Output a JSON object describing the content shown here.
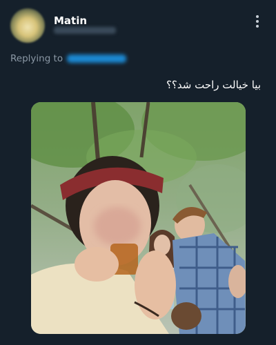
{
  "tweet": {
    "author_name": "Matin",
    "replying_to_label": "Replying to",
    "text": "بیا خیالت راحت شد؟؟",
    "more_icon": "more-vertical-icon",
    "colors": {
      "background": "#15202b",
      "secondary_text": "#8b98a5",
      "accent": "#1d9bf0"
    }
  }
}
